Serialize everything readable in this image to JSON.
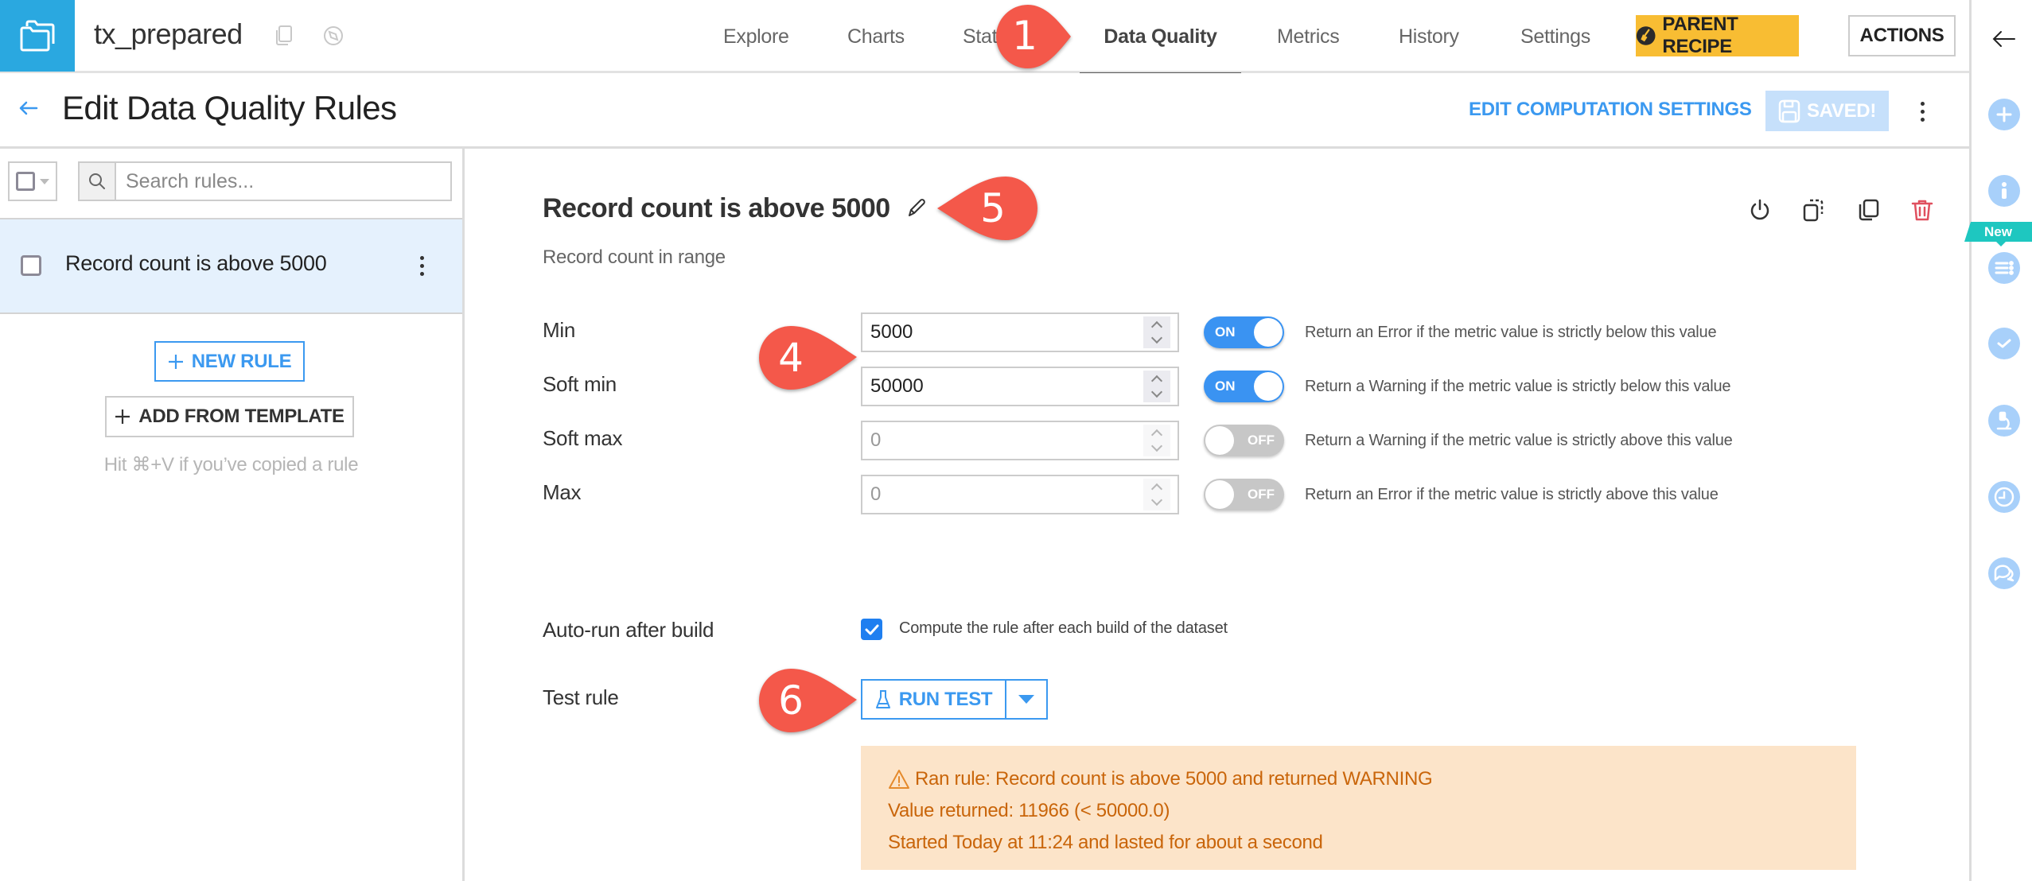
{
  "topbar": {
    "dataset_name": "tx_prepared",
    "tabs": [
      {
        "label": "Explore",
        "active": false
      },
      {
        "label": "Charts",
        "active": false
      },
      {
        "label": "Statistics",
        "active": false
      },
      {
        "label": "Data Quality",
        "active": true
      },
      {
        "label": "Metrics",
        "active": false
      },
      {
        "label": "History",
        "active": false
      },
      {
        "label": "Settings",
        "active": false
      }
    ],
    "parent_recipe_label": "PARENT RECIPE",
    "actions_label": "ACTIONS"
  },
  "subheader": {
    "title": "Edit Data Quality Rules",
    "edit_computation_label": "EDIT COMPUTATION SETTINGS",
    "saved_label": "SAVED!"
  },
  "left_panel": {
    "search_placeholder": "Search rules...",
    "rules": [
      {
        "label": "Record count is above 5000",
        "selected": true,
        "checked": false
      }
    ],
    "new_rule_label": "NEW RULE",
    "add_from_template_label": "ADD FROM TEMPLATE",
    "paste_hint": "Hit ⌘+V if you’ve copied a rule"
  },
  "rule": {
    "title": "Record count is above 5000",
    "type": "Record count in range",
    "fields": [
      {
        "label": "Min",
        "value": "5000",
        "enabled": true,
        "toggle_label": "ON",
        "help": "Return an Error if the metric value is strictly below this value"
      },
      {
        "label": "Soft min",
        "value": "50000",
        "enabled": true,
        "toggle_label": "ON",
        "help": "Return a Warning if the metric value is strictly below this value"
      },
      {
        "label": "Soft max",
        "value": "0",
        "enabled": false,
        "toggle_label": "OFF",
        "help": "Return a Warning if the metric value is strictly above this value"
      },
      {
        "label": "Max",
        "value": "0",
        "enabled": false,
        "toggle_label": "OFF",
        "help": "Return an Error if the metric value is strictly above this value"
      }
    ],
    "autorun_label": "Auto-run after build",
    "autorun_checked": true,
    "autorun_help": "Compute the rule after each build of the dataset",
    "test_label": "Test rule",
    "run_test_label": "RUN TEST",
    "result": {
      "status": "WARNING",
      "line1": "Ran rule: Record count is above 5000 and returned WARNING",
      "line2": "Value returned: 11966 (< 50000.0)",
      "line3": "Started Today at 11:24 and lasted for about a second"
    }
  },
  "right_sidebar": {
    "new_badge": "New",
    "items": [
      "add-icon",
      "info-icon",
      "list-icon",
      "check-icon",
      "lab-icon",
      "clock-icon",
      "chat-icon"
    ]
  },
  "callouts": [
    "1",
    "4",
    "5",
    "6"
  ],
  "colors": {
    "brand_blue": "#2aa8e0",
    "accent_blue": "#3b99f0",
    "parent_recipe_yellow": "#f8bd33",
    "callout_red": "#f4584a",
    "warning_bg": "#fce4c9",
    "warning_text": "#c9650a",
    "delete_red": "#e0505f",
    "new_badge_teal": "#1ec7c0"
  }
}
